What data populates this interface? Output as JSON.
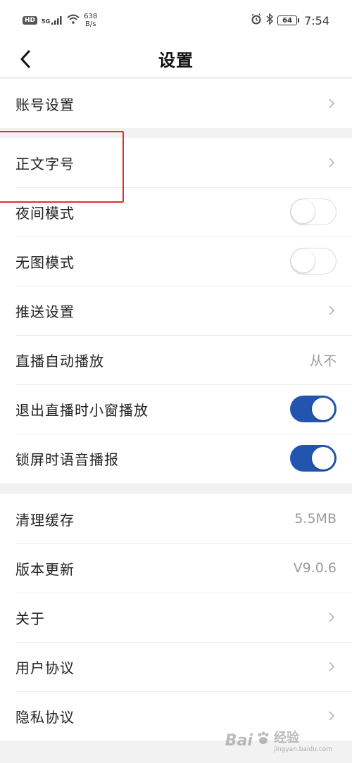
{
  "status_bar": {
    "hd": "HD",
    "signal": "5G",
    "speed_value": "638",
    "speed_unit": "B/s",
    "battery": "64",
    "time": "7:54"
  },
  "header": {
    "title": "设置"
  },
  "groups": {
    "account": {
      "label": "账号设置"
    },
    "display": {
      "font_size": "正文字号",
      "night_mode": "夜间模式",
      "no_image_mode": "无图模式",
      "push": "推送设置",
      "autoplay": "直播自动播放",
      "autoplay_value": "从不",
      "mini_window": "退出直播时小窗播放",
      "lock_voice": "锁屏时语音播报"
    },
    "toggles": {
      "night_mode": false,
      "no_image_mode": false,
      "mini_window": true,
      "lock_voice": true
    },
    "other": {
      "clear_cache": "清理缓存",
      "cache_size": "5.5MB",
      "update": "版本更新",
      "version": "V9.0.6",
      "about": "关于",
      "user_agreement": "用户协议",
      "privacy": "隐私协议"
    }
  },
  "watermark": {
    "brand": "Bai",
    "brand2": "经验",
    "url": "jingyan.baidu.com"
  },
  "colors": {
    "accent": "#2155b0",
    "highlight": "#e0302c"
  }
}
